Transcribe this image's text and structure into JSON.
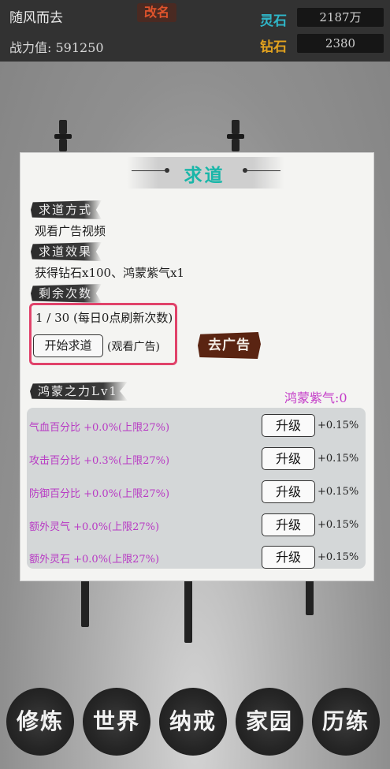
{
  "header": {
    "player_name": "随风而去",
    "rename_label": "改名",
    "power_label": "战力值:",
    "power_value": "591250",
    "lingshi_label": "灵石",
    "lingshi_value": "2187万",
    "zuanshi_label": "钻石",
    "zuanshi_value": "2380"
  },
  "dialog": {
    "title": "求道",
    "method_label": "求道方式",
    "method_text": "观看广告视频",
    "effect_label": "求道效果",
    "effect_text": "获得钻石x100、鸿蒙紫气x1",
    "remaining_label": "剩余次数",
    "remaining_text": "1 / 30 (每日0点刷新次数)",
    "start_label": "开始求道",
    "ad_note": "(观看广告)",
    "go_ad_label": "去广告",
    "hongmeng_title": "鸿蒙之力Lv1",
    "hongmeng_qi": "鸿蒙紫气:0",
    "upgrade_label": "升级",
    "attributes": [
      {
        "text": "气血百分比 +0.0%(上限27%)",
        "bonus": "+0.15%"
      },
      {
        "text": "攻击百分比 +0.3%(上限27%)",
        "bonus": "+0.15%"
      },
      {
        "text": "防御百分比 +0.0%(上限27%)",
        "bonus": "+0.15%"
      },
      {
        "text": "额外灵气 +0.0%(上限27%)",
        "bonus": "+0.15%"
      },
      {
        "text": "额外灵石 +0.0%(上限27%)",
        "bonus": "+0.15%"
      }
    ]
  },
  "nav": {
    "items": [
      {
        "label": "修炼"
      },
      {
        "label": "世界"
      },
      {
        "label": "纳戒"
      },
      {
        "label": "家园"
      },
      {
        "label": "历练"
      }
    ]
  }
}
